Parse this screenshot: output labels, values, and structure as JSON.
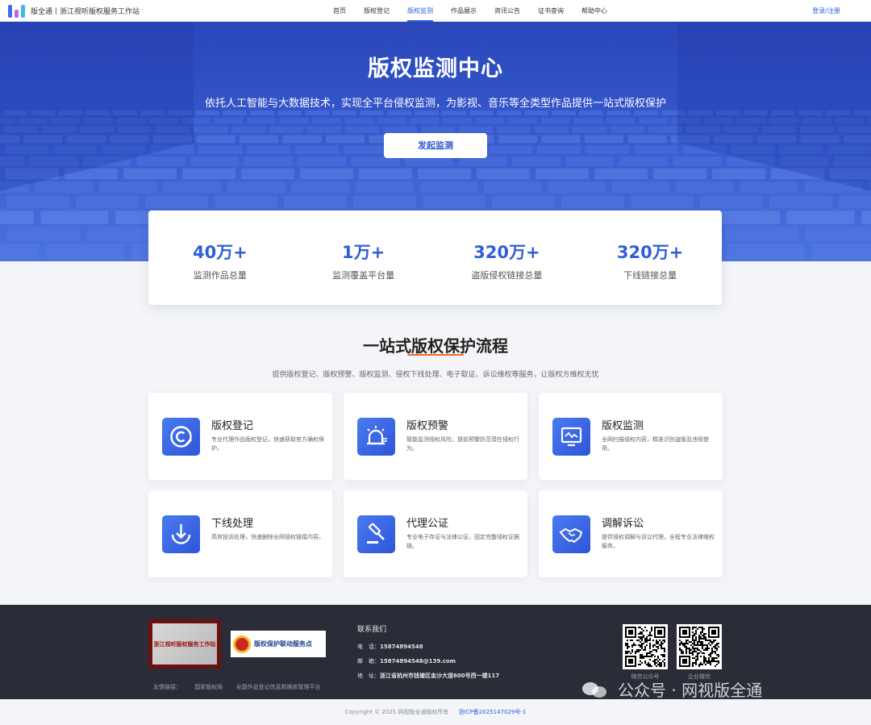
{
  "header": {
    "brand": "版全通丨浙江视听版权服务工作站",
    "nav": [
      "首页",
      "版权登记",
      "版权监测",
      "作品展示",
      "资讯公告",
      "证书查询",
      "帮助中心"
    ],
    "active_nav": "版权监测",
    "login": "登录/注册"
  },
  "hero": {
    "title": "版权监测中心",
    "subtitle": "依托人工智能与大数据技术，实现全平台侵权监测，为影视、音乐等全类型作品提供一站式版权保护",
    "button": "发起监测"
  },
  "stats": [
    {
      "value": "40万+",
      "label": "监测作品总量"
    },
    {
      "value": "1万+",
      "label": "监测覆盖平台量"
    },
    {
      "value": "320万+",
      "label": "盗版侵权链接总量"
    },
    {
      "value": "320万+",
      "label": "下线链接总量"
    }
  ],
  "section": {
    "title": "一站式版权保护流程",
    "desc": "提供版权登记、版权预警、版权监测、侵权下线处理、电子取证、诉讼维权等服务，让版权方维权无忧"
  },
  "services": [
    {
      "title": "版权登记",
      "desc": "专业代理作品版权登记，快速获取官方确权保护。",
      "icon": "copyright-icon"
    },
    {
      "title": "版权预警",
      "desc": "智能监测侵权风险，提前预警防范潜在侵权行为。",
      "icon": "alarm-icon"
    },
    {
      "title": "版权监测",
      "desc": "全网扫描侵权内容，精准识别盗版及违规使用。",
      "icon": "monitor-icon"
    },
    {
      "title": "下线处理",
      "desc": "高效投诉处理，快速删除全网侵权链接内容。",
      "icon": "download-icon"
    },
    {
      "title": "代理公证",
      "desc": "专业电子存证与法律公证，固定完整侵权证据链。",
      "icon": "gavel-icon"
    },
    {
      "title": "调解诉讼",
      "desc": "提供侵权调解与诉讼代理，全程专业法律维权服务。",
      "icon": "handshake-icon"
    }
  ],
  "footer": {
    "cert1": "浙江视听版权服务工作站",
    "cert2": "版权保护联动服务点",
    "friend_links_label": "友情链接：",
    "friend_links": [
      "国家版权局",
      "全国作品登记信息数据库管理平台"
    ],
    "contact_title": "联系我们",
    "contacts": [
      {
        "k": "电　话：",
        "v": "15874894548"
      },
      {
        "k": "邮　箱：",
        "v": "15874894548@139.com"
      },
      {
        "k": "地　址：",
        "v": "浙江省杭州市钱塘区金沙大道600号西一楼117"
      }
    ],
    "qr_labels": [
      "微信公众号",
      "企业微信"
    ],
    "watermark": "公众号 · 网视版全通"
  },
  "copyright": {
    "text": "Copyright © 2025 网视版全通版权所有",
    "icp": "浙ICP备2025147029号-1"
  },
  "colors": {
    "primary": "#2b5de0",
    "accent": "#ee6b2d",
    "footer_bg": "#2a2d37"
  }
}
